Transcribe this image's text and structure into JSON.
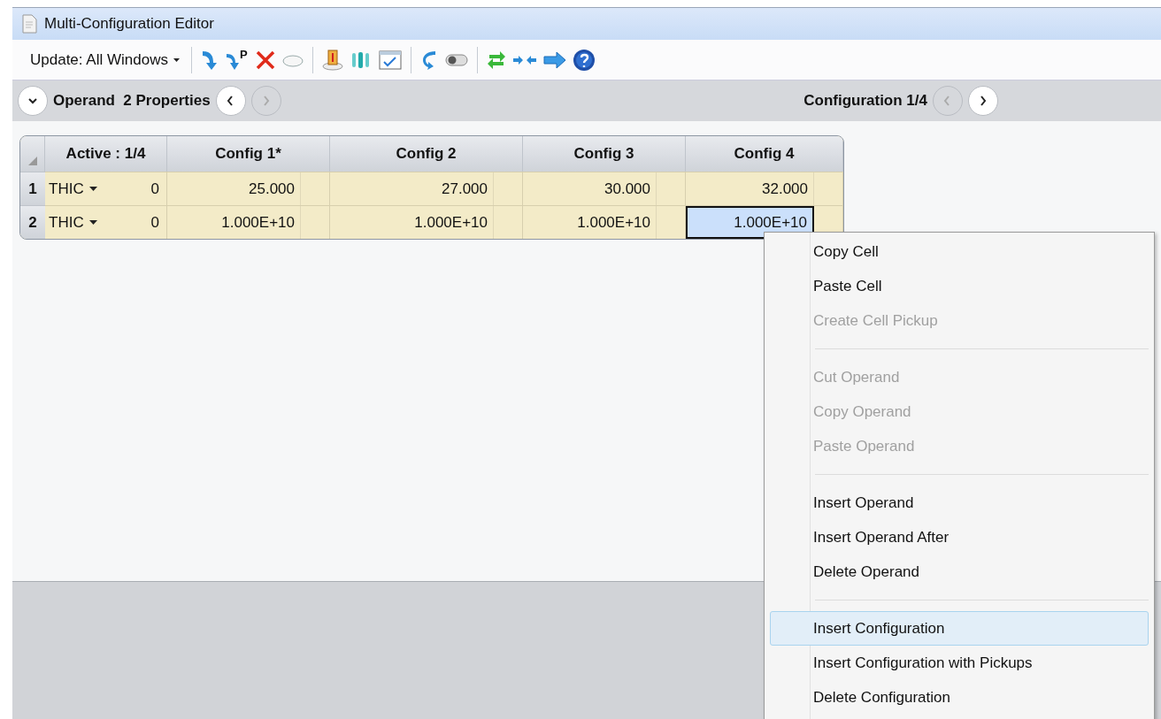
{
  "window": {
    "title": "Multi-Configuration Editor"
  },
  "toolbar": {
    "update_dropdown": "Update: All Windows",
    "pickup_letter": "P"
  },
  "property_bar": {
    "label": "Operand  2 Properties",
    "prev_disabled": false,
    "next_disabled": true,
    "config_label": "Configuration 1/4",
    "config_prev_disabled": true,
    "config_next_disabled": false
  },
  "table": {
    "columns": [
      "Active : 1/4",
      "Config 1*",
      "Config 2",
      "Config 3",
      "Config 4"
    ],
    "rows": [
      {
        "number": "1",
        "operand": "THIC",
        "param": "0",
        "values": [
          {
            "text": "25.000",
            "selected": false
          },
          {
            "text": "27.000",
            "selected": false
          },
          {
            "text": "30.000",
            "selected": false
          },
          {
            "text": "32.000",
            "selected": false
          }
        ]
      },
      {
        "number": "2",
        "operand": "THIC",
        "param": "0",
        "values": [
          {
            "text": "1.000E+10",
            "selected": false
          },
          {
            "text": "1.000E+10",
            "selected": false
          },
          {
            "text": "1.000E+10",
            "selected": false
          },
          {
            "text": "1.000E+10",
            "selected": true
          }
        ]
      }
    ]
  },
  "context_menu": [
    {
      "kind": "item",
      "label": "Copy Cell",
      "disabled": false,
      "selected": false
    },
    {
      "kind": "item",
      "label": "Paste Cell",
      "disabled": false,
      "selected": false
    },
    {
      "kind": "item",
      "label": "Create Cell Pickup",
      "disabled": true,
      "selected": false
    },
    {
      "kind": "separator"
    },
    {
      "kind": "item",
      "label": "Cut Operand",
      "disabled": true,
      "selected": false
    },
    {
      "kind": "item",
      "label": "Copy Operand",
      "disabled": true,
      "selected": false
    },
    {
      "kind": "item",
      "label": "Paste Operand",
      "disabled": true,
      "selected": false
    },
    {
      "kind": "separator"
    },
    {
      "kind": "item",
      "label": "Insert Operand",
      "disabled": false,
      "selected": false
    },
    {
      "kind": "item",
      "label": "Insert Operand After",
      "disabled": false,
      "selected": false
    },
    {
      "kind": "item",
      "label": "Delete Operand",
      "disabled": false,
      "selected": false
    },
    {
      "kind": "separator"
    },
    {
      "kind": "item",
      "label": "Insert Configuration",
      "disabled": false,
      "selected": true
    },
    {
      "kind": "item",
      "label": "Insert Configuration with Pickups",
      "disabled": false,
      "selected": false
    },
    {
      "kind": "item",
      "label": "Delete Configuration",
      "disabled": false,
      "selected": false
    }
  ]
}
